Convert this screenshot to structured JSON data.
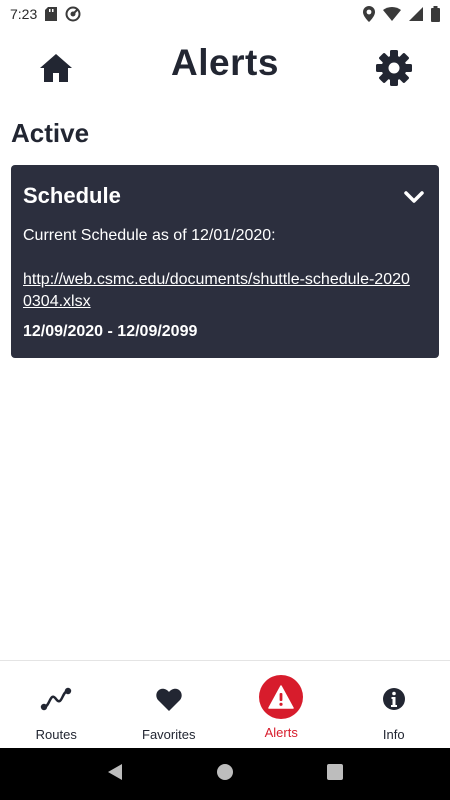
{
  "status_bar": {
    "time": "7:23",
    "icons_left": [
      "sd-card-icon",
      "sync-icon"
    ],
    "icons_right": [
      "location-icon",
      "wifi-icon",
      "signal-icon",
      "battery-icon"
    ]
  },
  "header": {
    "title": "Alerts",
    "home_icon": "home-icon",
    "settings_icon": "gear-icon"
  },
  "section": {
    "title": "Active"
  },
  "alerts": [
    {
      "title": "Schedule",
      "body": "Current Schedule as of 12/01/2020:",
      "link": "http://web.csmc.edu/documents/shuttle-schedule-20200304.xlsx",
      "dates": "12/09/2020 - 12/09/2099",
      "expanded": true
    }
  ],
  "bottom_nav": {
    "items": [
      {
        "label": "Routes",
        "icon": "route-icon"
      },
      {
        "label": "Favorites",
        "icon": "heart-icon"
      },
      {
        "label": "Alerts",
        "icon": "warning-icon",
        "active": true
      },
      {
        "label": "Info",
        "icon": "info-icon"
      }
    ]
  },
  "colors": {
    "primary": "#222632",
    "card": "#2c2f3e",
    "accent": "#d71c2c",
    "background": "#ffffff"
  }
}
